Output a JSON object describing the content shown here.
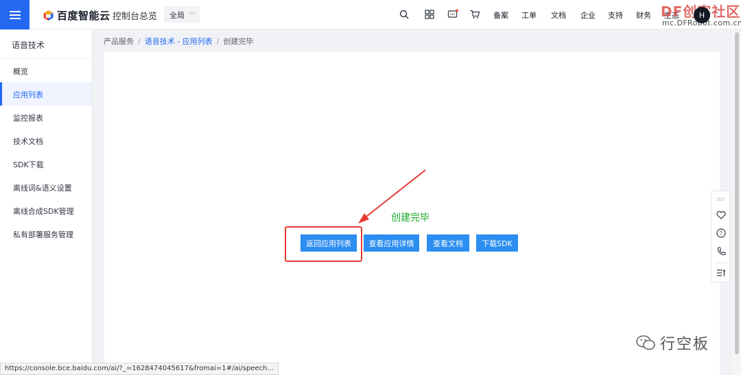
{
  "header": {
    "logo_text": "百度智能云",
    "console_home": "控制台总览",
    "region": "全局",
    "nav_links": [
      "备案",
      "工单",
      "文档",
      "企业",
      "支持",
      "财务",
      "生态"
    ],
    "avatar_initial": "H",
    "watermark_title": "DF创客社区",
    "watermark_url": "mc.DFRobot.com.cn"
  },
  "sidebar": {
    "title": "语音技术",
    "items": [
      {
        "label": "概览"
      },
      {
        "label": "应用列表"
      },
      {
        "label": "监控报表"
      },
      {
        "label": "技术文档"
      },
      {
        "label": "SDK下载"
      },
      {
        "label": "离线词&语义设置"
      },
      {
        "label": "离线合成SDK管理"
      },
      {
        "label": "私有部署服务管理"
      }
    ],
    "active_index": 1
  },
  "breadcrumb": {
    "root": "产品服务",
    "section": "语音技术 - 应用列表",
    "current": "创建完毕",
    "separator": "/"
  },
  "main": {
    "status_title": "创建完毕",
    "buttons": {
      "back_to_list": "返回应用列表",
      "view_details": "查看应用详情",
      "view_docs": "查看文档",
      "download_sdk": "下载SDK"
    }
  },
  "status_bar": {
    "url": "https://console.bce.baidu.com/ai/?_=1628474045617&fromai=1#/ai/speech..."
  },
  "wechat_watermark": "行空板",
  "colors": {
    "primary": "#2468f2",
    "button_blue": "#2b8ef0",
    "success_green": "#1aab2a",
    "annotation_red": "#e53935"
  }
}
